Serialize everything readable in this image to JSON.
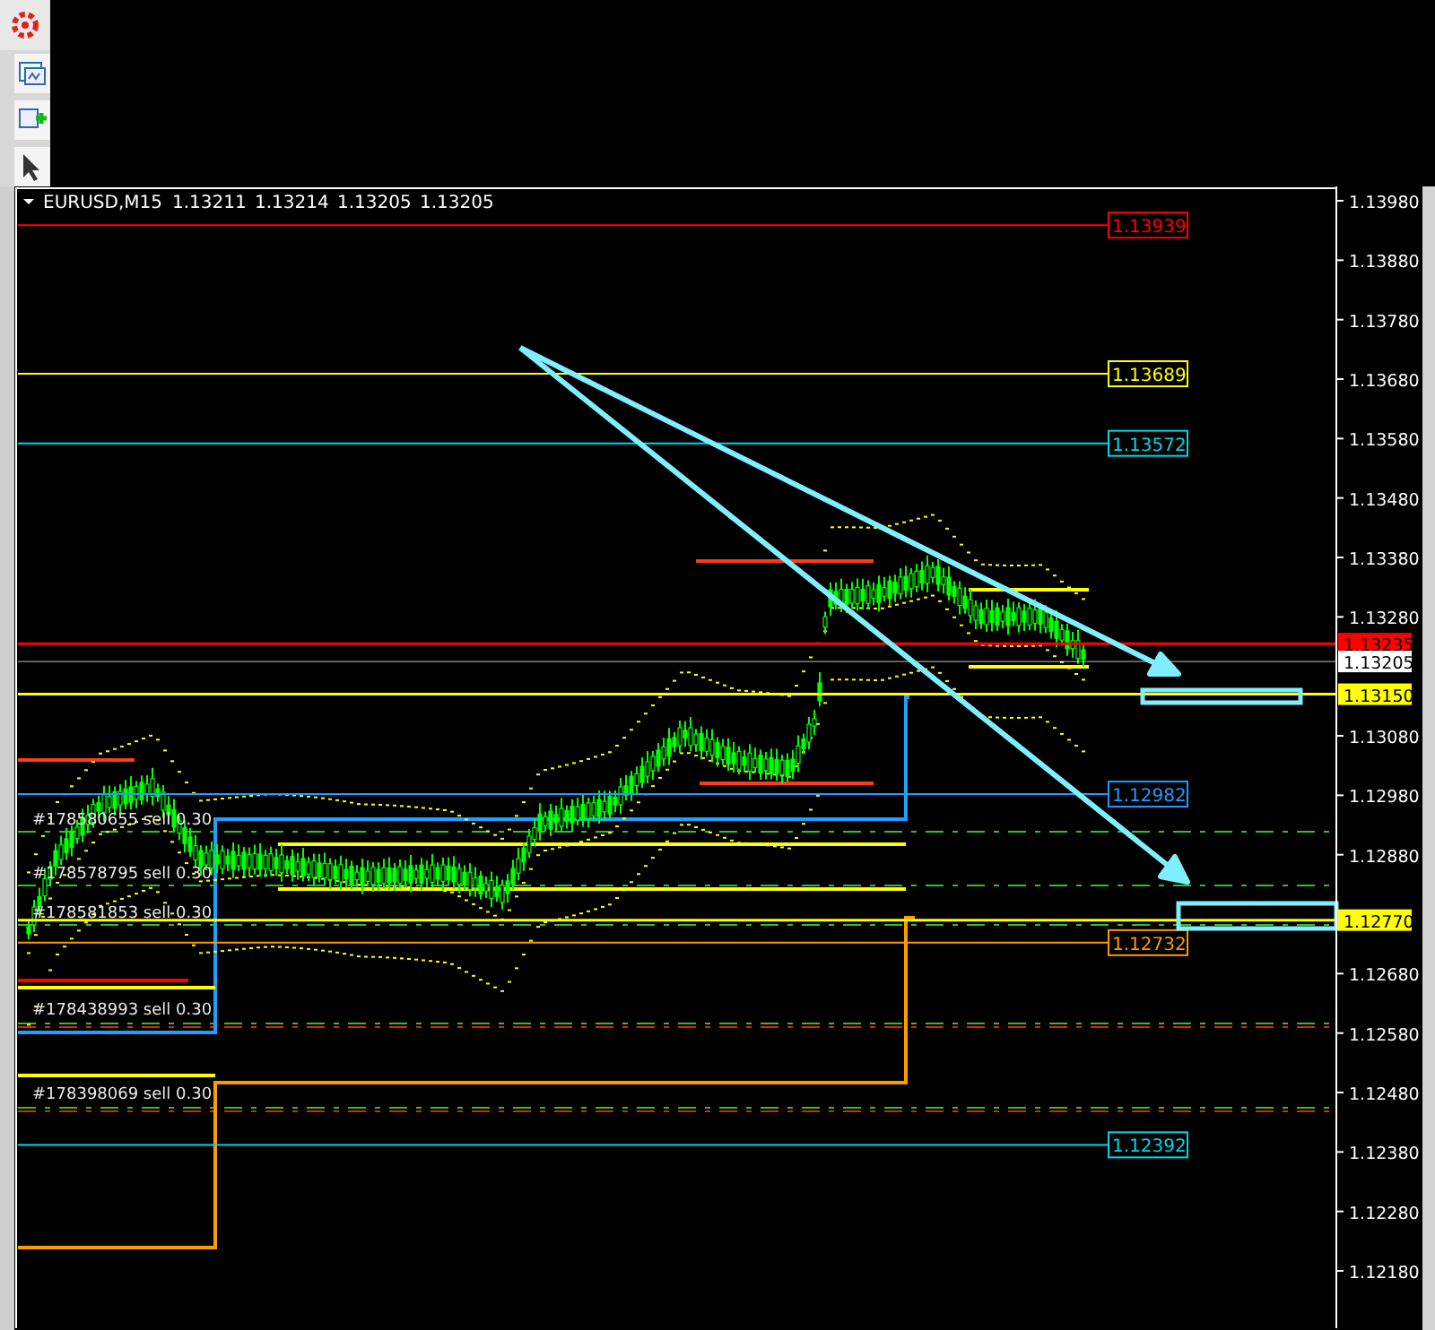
{
  "header": {
    "symbol": "EURUSD,M15",
    "quotes": [
      "1.13211",
      "1.13214",
      "1.13205",
      "1.13205"
    ]
  },
  "price_axis": {
    "ticks": [
      "1.13980",
      "1.13880",
      "1.13780",
      "1.13680",
      "1.13580",
      "1.13480",
      "1.13380",
      "1.13280",
      "1.13080",
      "1.12980",
      "1.12880",
      "1.12680",
      "1.12580",
      "1.12480",
      "1.12380",
      "1.12280",
      "1.12180"
    ]
  },
  "axis_tags": [
    {
      "label": "1.13235",
      "color": "#ff0000"
    },
    {
      "label": "1.13205",
      "color": "#ffffff"
    },
    {
      "label": "1.13150",
      "color": "#ffff00"
    },
    {
      "label": "1.12770",
      "color": "#ffff00"
    }
  ],
  "price_levels": [
    {
      "label": "1.13939",
      "color": "#ff0000"
    },
    {
      "label": "1.13689",
      "color": "#ffff00"
    },
    {
      "label": "1.13572",
      "color": "#00d8e8"
    },
    {
      "label": "1.12982",
      "color": "#1e9cff"
    },
    {
      "label": "1.12732",
      "color": "#ff9a00"
    },
    {
      "label": "1.12392",
      "color": "#00d8e8"
    }
  ],
  "orders": [
    "#178580655 sell 0.30",
    "#178578795 sell 0.30",
    "#178581853 sell 0.30",
    "#178438993 sell 0.30",
    "#178398069 sell 0.30"
  ]
}
